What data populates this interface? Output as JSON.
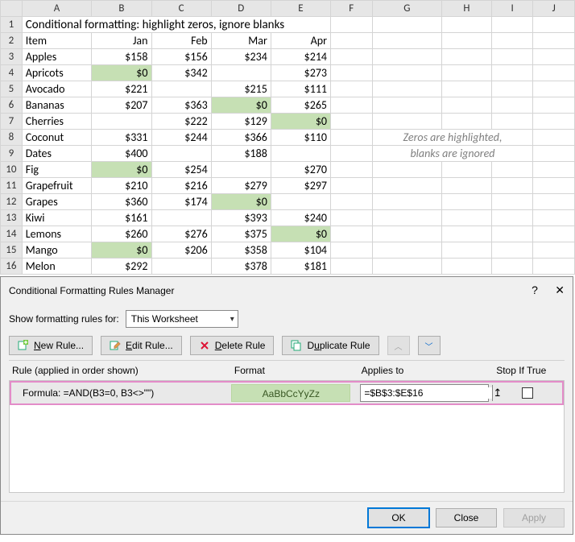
{
  "title": "Conditional formatting: highlight zeros, ignore blanks",
  "col_headers": [
    "A",
    "B",
    "C",
    "D",
    "E",
    "F",
    "G",
    "H",
    "I",
    "J"
  ],
  "row_numbers": [
    "1",
    "2",
    "3",
    "4",
    "5",
    "6",
    "7",
    "8",
    "9",
    "10",
    "11",
    "12",
    "13",
    "14",
    "15",
    "16"
  ],
  "headers": {
    "item": "Item",
    "jan": "Jan",
    "feb": "Feb",
    "mar": "Mar",
    "apr": "Apr"
  },
  "note1": "Zeros are highlighted,",
  "note2": "blanks are ignored",
  "rows": [
    {
      "item": "Apples",
      "jan": "$158",
      "feb": "$156",
      "mar": "$234",
      "apr": "$214"
    },
    {
      "item": "Apricots",
      "jan": "$0",
      "jan_hl": true,
      "feb": "$342",
      "mar": "",
      "apr": "$273"
    },
    {
      "item": "Avocado",
      "jan": "$221",
      "feb": "",
      "mar": "$215",
      "apr": "$111"
    },
    {
      "item": "Bananas",
      "jan": "$207",
      "feb": "$363",
      "mar": "$0",
      "mar_hl": true,
      "apr": "$265"
    },
    {
      "item": "Cherries",
      "jan": "",
      "feb": "$222",
      "mar": "$129",
      "apr": "$0",
      "apr_hl": true
    },
    {
      "item": "Coconut",
      "jan": "$331",
      "feb": "$244",
      "mar": "$366",
      "apr": "$110"
    },
    {
      "item": "Dates",
      "jan": "$400",
      "feb": "",
      "mar": "$188",
      "apr": ""
    },
    {
      "item": "Fig",
      "jan": "$0",
      "jan_hl": true,
      "feb": "$254",
      "mar": "",
      "apr": "$270"
    },
    {
      "item": "Grapefruit",
      "jan": "$210",
      "feb": "$216",
      "mar": "$279",
      "apr": "$297"
    },
    {
      "item": "Grapes",
      "jan": "$360",
      "feb": "$174",
      "mar": "$0",
      "mar_hl": true,
      "apr": ""
    },
    {
      "item": "Kiwi",
      "jan": "$161",
      "feb": "",
      "mar": "$393",
      "apr": "$240"
    },
    {
      "item": "Lemons",
      "jan": "$260",
      "feb": "$276",
      "mar": "$375",
      "apr": "$0",
      "apr_hl": true
    },
    {
      "item": "Mango",
      "jan": "$0",
      "jan_hl": true,
      "feb": "$206",
      "mar": "$358",
      "apr": "$104"
    },
    {
      "item": "Melon",
      "jan": "$292",
      "feb": "",
      "mar": "$378",
      "apr": "$181"
    }
  ],
  "dialog": {
    "title": "Conditional Formatting Rules Manager",
    "show_label": "Show formatting rules for:",
    "scope": "This Worksheet",
    "btn_new": "New Rule...",
    "btn_new_u": "N",
    "btn_edit": "Edit Rule...",
    "btn_edit_u": "E",
    "btn_delete": "Delete Rule",
    "btn_delete_u": "D",
    "btn_dup": "Duplicate Rule",
    "btn_dup_u": "u",
    "hdr_rule": "Rule (applied in order shown)",
    "hdr_format": "Format",
    "hdr_applies": "Applies to",
    "hdr_stop": "Stop If True",
    "rule_text": "Formula: =AND(B3=0, B3<>\"\")",
    "preview": "AaBbCcYyZz",
    "applies": "=$B$3:$E$16",
    "ok": "OK",
    "close": "Close",
    "apply": "Apply"
  }
}
